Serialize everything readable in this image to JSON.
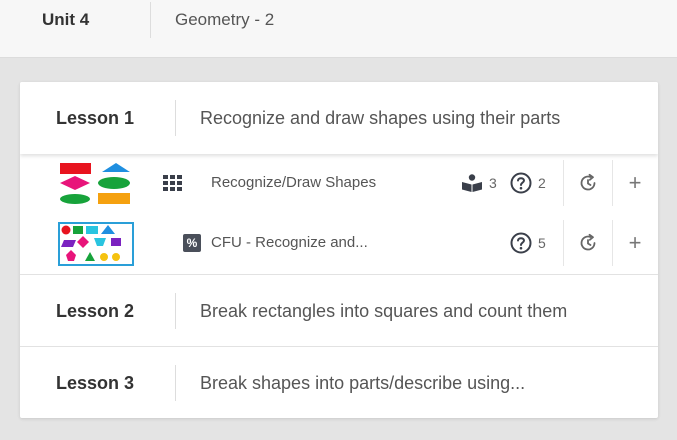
{
  "unit": {
    "label": "Unit 4",
    "title": "Geometry - 2"
  },
  "lessons": [
    {
      "label": "Lesson 1",
      "title": "Recognize and draw shapes using their parts",
      "activities": [
        {
          "title": "Recognize/Draw Shapes",
          "readings": "3",
          "questions": "2"
        },
        {
          "title": "CFU - Recognize and...",
          "questions": "5",
          "type_badge": "%"
        }
      ]
    },
    {
      "label": "Lesson 2",
      "title": "Break rectangles into squares and count them"
    },
    {
      "label": "Lesson 3",
      "title": "Break shapes into parts/describe using..."
    }
  ],
  "icons": {
    "schedule": "clock-refresh-icon",
    "add": "+",
    "readings": "reader-icon",
    "questions": "question-circle-icon"
  },
  "colors": {
    "background": "#e4e4e4",
    "header_bg": "#f7f7f7",
    "card_bg": "#ffffff",
    "text_dark": "#333333",
    "text_mid": "#555555"
  }
}
